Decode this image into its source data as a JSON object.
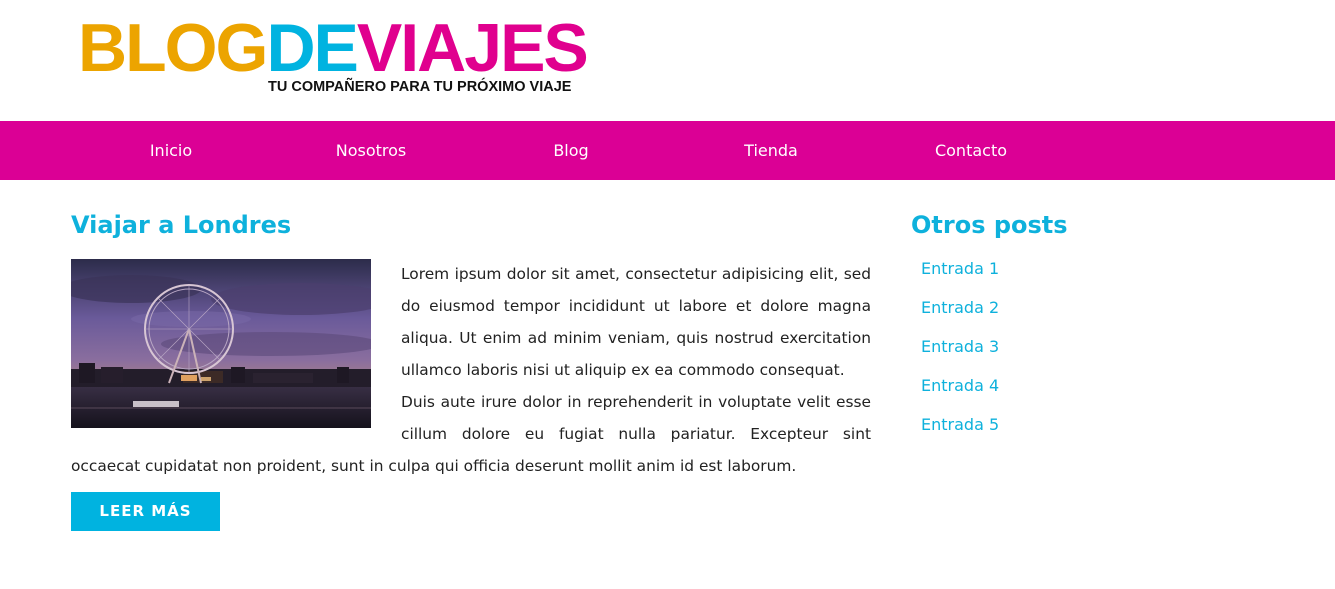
{
  "brand": {
    "logo_part_1": "BLOG",
    "logo_part_2": "DE",
    "logo_part_3": "VIAJES",
    "tagline": "TU COMPAÑERO PARA TU PRÓXIMO VIAJE",
    "colors": {
      "orange": "#eca400",
      "blue": "#00b3e0",
      "magenta": "#e0008e"
    }
  },
  "nav": {
    "background": "#db0095",
    "items": [
      {
        "label": "Inicio"
      },
      {
        "label": "Nosotros"
      },
      {
        "label": "Blog"
      },
      {
        "label": "Tienda"
      },
      {
        "label": "Contacto"
      }
    ]
  },
  "post": {
    "title": "Viajar a Londres",
    "image": "london-eye-photo",
    "paragraph_1": "Lorem ipsum dolor sit amet, consectetur adipisicing elit, sed do eiusmod tempor incididunt ut labore et dolore magna aliqua. Ut enim ad minim veniam, quis nostrud exercitation ullamco laboris nisi ut aliquip ex ea commodo consequat.",
    "paragraph_2": "Duis aute irure dolor in reprehenderit in voluptate velit esse cillum dolore eu fugiat nulla pariatur. Excepteur sint occaecat cupidatat non proident, sunt in culpa qui officia deserunt mollit anim id est laborum.",
    "read_more_label": "LEER MÁS"
  },
  "sidebar": {
    "title": "Otros posts",
    "entries": [
      {
        "label": "Entrada 1"
      },
      {
        "label": "Entrada 2"
      },
      {
        "label": "Entrada 3"
      },
      {
        "label": "Entrada 4"
      },
      {
        "label": "Entrada 5"
      }
    ]
  }
}
